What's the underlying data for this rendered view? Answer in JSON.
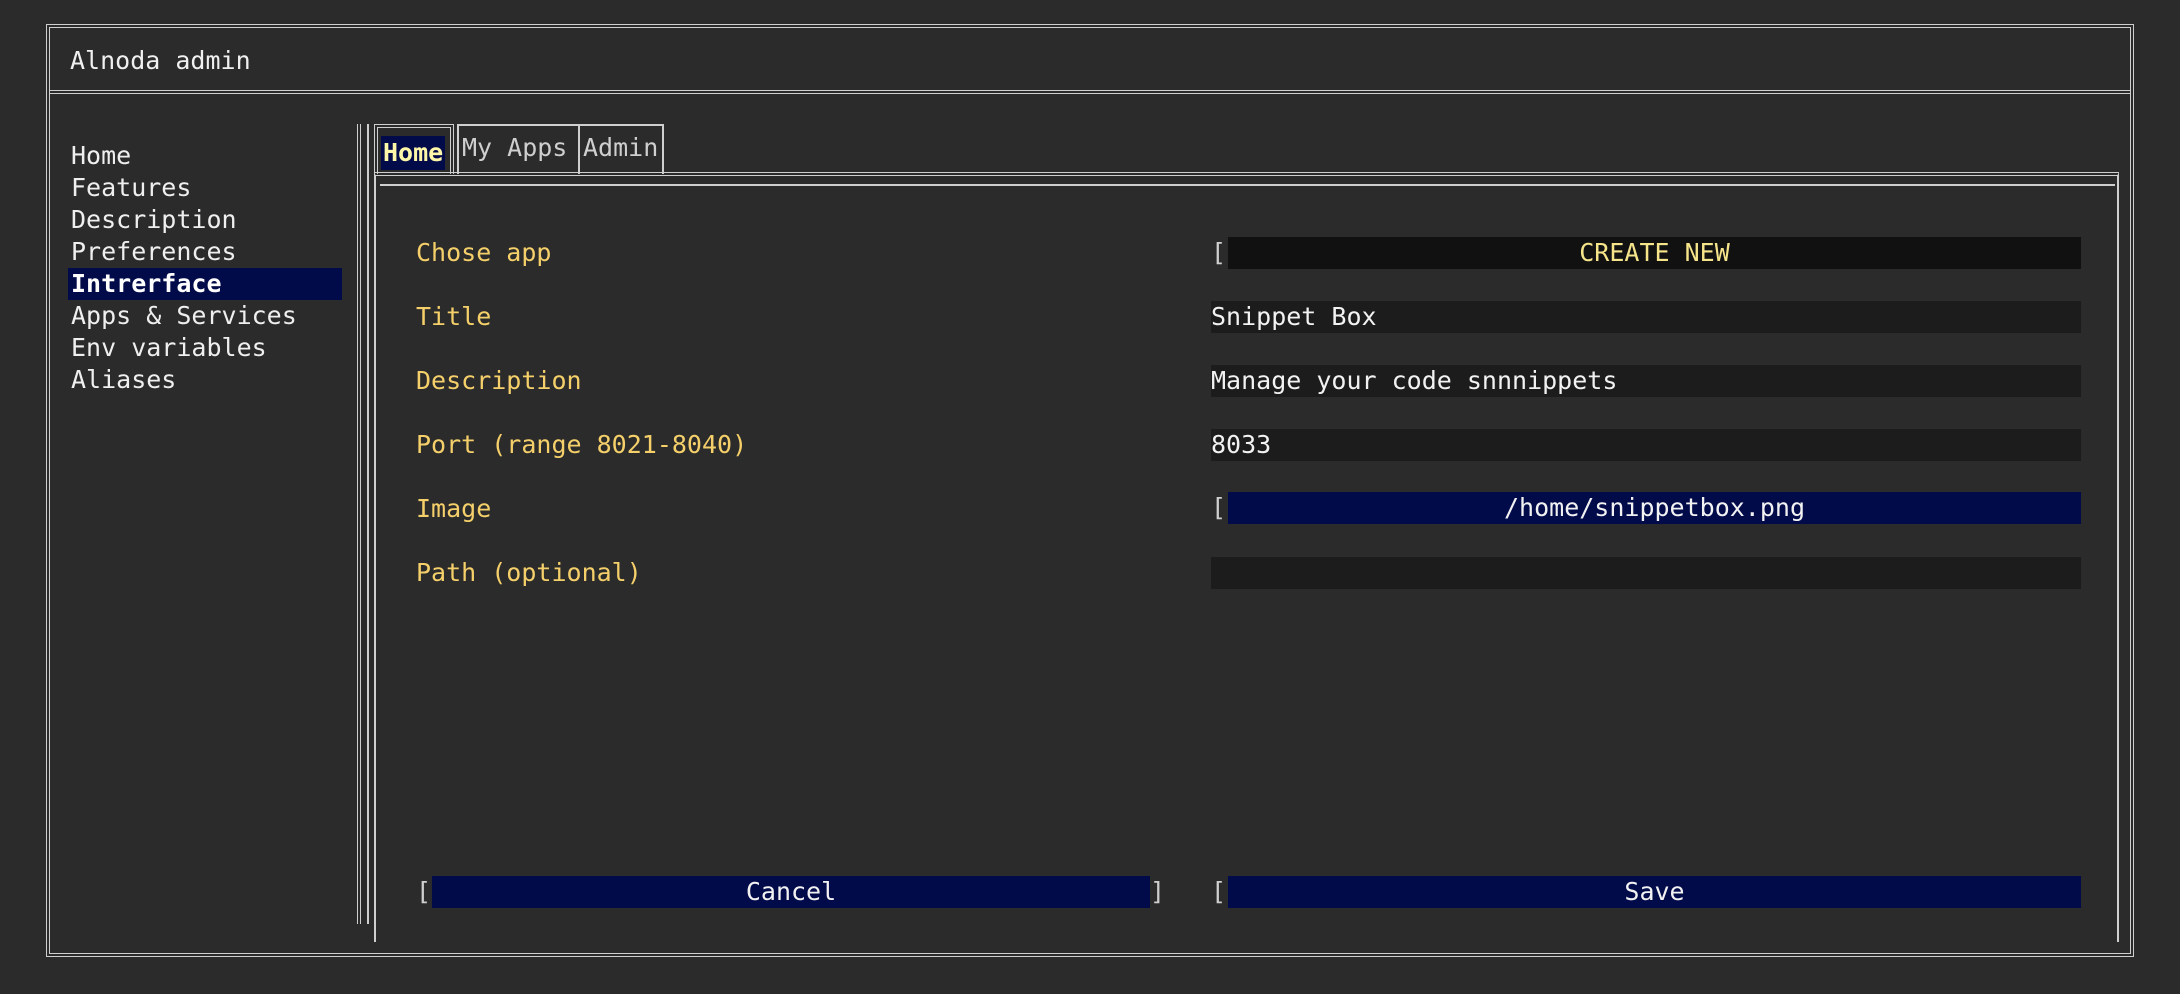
{
  "app": {
    "title": "Alnoda admin"
  },
  "sidebar": {
    "items": [
      {
        "label": "Home"
      },
      {
        "label": "Features"
      },
      {
        "label": "Description"
      },
      {
        "label": "Preferences"
      },
      {
        "label": "Intrerface",
        "active": true
      },
      {
        "label": "Apps & Services"
      },
      {
        "label": "Env variables"
      },
      {
        "label": "Aliases"
      }
    ]
  },
  "tabs": [
    {
      "label": "Home",
      "active": true
    },
    {
      "label": "My Apps"
    },
    {
      "label": "Admin"
    }
  ],
  "form": {
    "chose_app": {
      "label": "Chose app",
      "value": "CREATE NEW"
    },
    "title": {
      "label": "Title",
      "value": "Snippet Box"
    },
    "description": {
      "label": "Description",
      "value": "Manage your code snnnippets"
    },
    "port": {
      "label": "Port (range 8021-8040)",
      "value": "8033"
    },
    "image": {
      "label": "Image",
      "value": "/home/snippetbox.png"
    },
    "path": {
      "label": "Path (optional)",
      "value": ""
    }
  },
  "buttons": {
    "cancel": "Cancel",
    "save": "Save",
    "bracket_open": "[",
    "bracket_close": "]"
  },
  "colors": {
    "background": "#2b2b2b",
    "label": "#f5d06a",
    "selection": "#020b4a",
    "border": "#cfcfcf"
  }
}
